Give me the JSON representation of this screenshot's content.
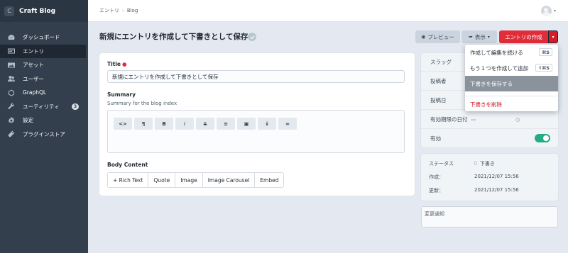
{
  "brand": {
    "logo_letter": "C",
    "name": "Craft Blog"
  },
  "nav": [
    {
      "label": "ダッシュボード",
      "icon": "dashboard-icon"
    },
    {
      "label": "エントリ",
      "icon": "entries-icon",
      "active": true
    },
    {
      "label": "アセット",
      "icon": "assets-icon"
    },
    {
      "label": "ユーザー",
      "icon": "users-icon"
    },
    {
      "label": "GraphQL",
      "icon": "graphql-icon"
    },
    {
      "label": "ユーティリティ",
      "icon": "wrench-icon",
      "badge": "3"
    },
    {
      "label": "設定",
      "icon": "gear-icon"
    },
    {
      "label": "プラグインストア",
      "icon": "plug-icon"
    }
  ],
  "breadcrumb": [
    "エントリ",
    "Blog"
  ],
  "page": {
    "title": "新規にエントリを作成して下書きとして保存"
  },
  "toolbar": {
    "preview": "プレビュー",
    "view": "表示",
    "create": "エントリの作成"
  },
  "dropdown": {
    "continue": "作成して編集を続ける",
    "continue_kbd": "⌘S",
    "another": "もう１つを作成して追加",
    "another_kbd": "⇧⌘S",
    "save_draft": "下書きを保存する",
    "delete_draft": "下書きを削除"
  },
  "fields": {
    "title_label": "Title",
    "title_value": "新規にエントリを作成して下書きとして保存",
    "summary_label": "Summary",
    "summary_instructions": "Summary for the blog index",
    "body_label": "Body Content"
  },
  "editor_buttons": [
    "<>",
    "¶",
    "B",
    "I",
    "S",
    "≡",
    "▣",
    "⤓",
    "∞"
  ],
  "block_types": [
    "+ Rich Text",
    "Quote",
    "Image",
    "Image Carousel",
    "Embed"
  ],
  "meta": {
    "slug": "スラッグ",
    "author": "投稿者",
    "post_date": "投稿日",
    "expiry_date": "有効期限の日付",
    "enabled": "有効",
    "enabled_value": true
  },
  "status": {
    "status_label": "ステータス",
    "status_value": "下書き",
    "created_label": "作成：",
    "created_value": "2021/12/07 15:56",
    "updated_label": "更新：",
    "updated_value": "2021/12/07 15:56"
  },
  "notes_placeholder": "変更通知",
  "colors": {
    "accent": "#e12d39",
    "sidebar": "#333f4d",
    "toggle_on": "#27ab83"
  }
}
